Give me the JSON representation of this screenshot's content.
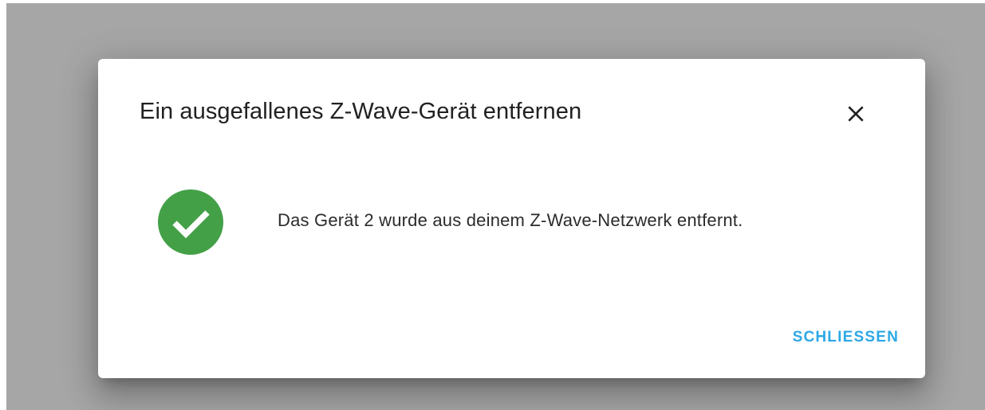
{
  "dialog": {
    "title": "Ein ausgefallenes Z-Wave-Gerät entfernen",
    "close_icon": "close-icon",
    "status_icon": "check-circle-icon",
    "status_color": "#43a047",
    "message": "Das Gerät 2 wurde aus deinem Z-Wave-Netzwerk entfernt.",
    "action_label": "SCHLIESSEN",
    "action_color": "#2ea8e6"
  }
}
